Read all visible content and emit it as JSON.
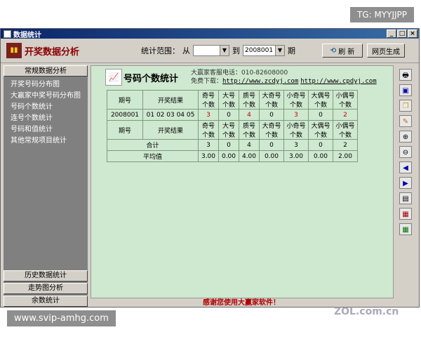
{
  "watermarks": {
    "top_right": "TG: MYYJJPP",
    "bottom_left": "www.svip-amhg.com",
    "zol": "ZOL.com.cn"
  },
  "window": {
    "title": "数据统计",
    "min": "_",
    "max": "□",
    "close": "×"
  },
  "toolbar": {
    "app_title": "开奖数据分析",
    "range_label": "统计范围：",
    "from_label": "从",
    "from_value": "",
    "to_label": "到",
    "to_value": "2008001",
    "period_label": "期",
    "refresh_label": "刷 新",
    "webpage_label": "网页生成"
  },
  "sidebar": {
    "head": "常规数据分析",
    "items": [
      "开奖号码分布图",
      "大赢家中奖号码分布图",
      "号码个数统计",
      "连号个数统计",
      "号码和值统计",
      "其他常规项目统计"
    ],
    "foot": [
      "历史数据统计",
      "走势图分析",
      "余数统计"
    ]
  },
  "main": {
    "title": "号码个数统计",
    "contact_phone": "大赢家客服电话：010-82608000",
    "download_label": "免费下载：",
    "link1": "http://www.zcdyj.com",
    "link2": "http://www.cpdyj.com",
    "table": {
      "h_period": "期号",
      "h_result": "开奖结果",
      "cols": [
        "奇号个数",
        "大号个数",
        "质号个数",
        "大奇号个数",
        "小奇号个数",
        "大偶号个数",
        "小偶号个数"
      ],
      "row_period": "2008001",
      "row_result": "01 02 03 04 05",
      "row_values": [
        "3",
        "0",
        "4",
        "0",
        "3",
        "0",
        "2"
      ],
      "total_label": "合计",
      "totals": [
        "3",
        "0",
        "4",
        "0",
        "3",
        "0",
        "2"
      ],
      "avg_label": "平均值",
      "avgs": [
        "3.00",
        "0.00",
        "4.00",
        "0.00",
        "3.00",
        "0.00",
        "2.00"
      ]
    }
  },
  "status": "感谢您使用大赢家软件！",
  "right_icons": [
    "print-icon",
    "save-icon",
    "copy-icon",
    "pen-icon",
    "zoom-in-icon",
    "zoom-out-icon",
    "prev-icon",
    "next-icon",
    "chart-icon",
    "report-icon",
    "grid-icon"
  ]
}
